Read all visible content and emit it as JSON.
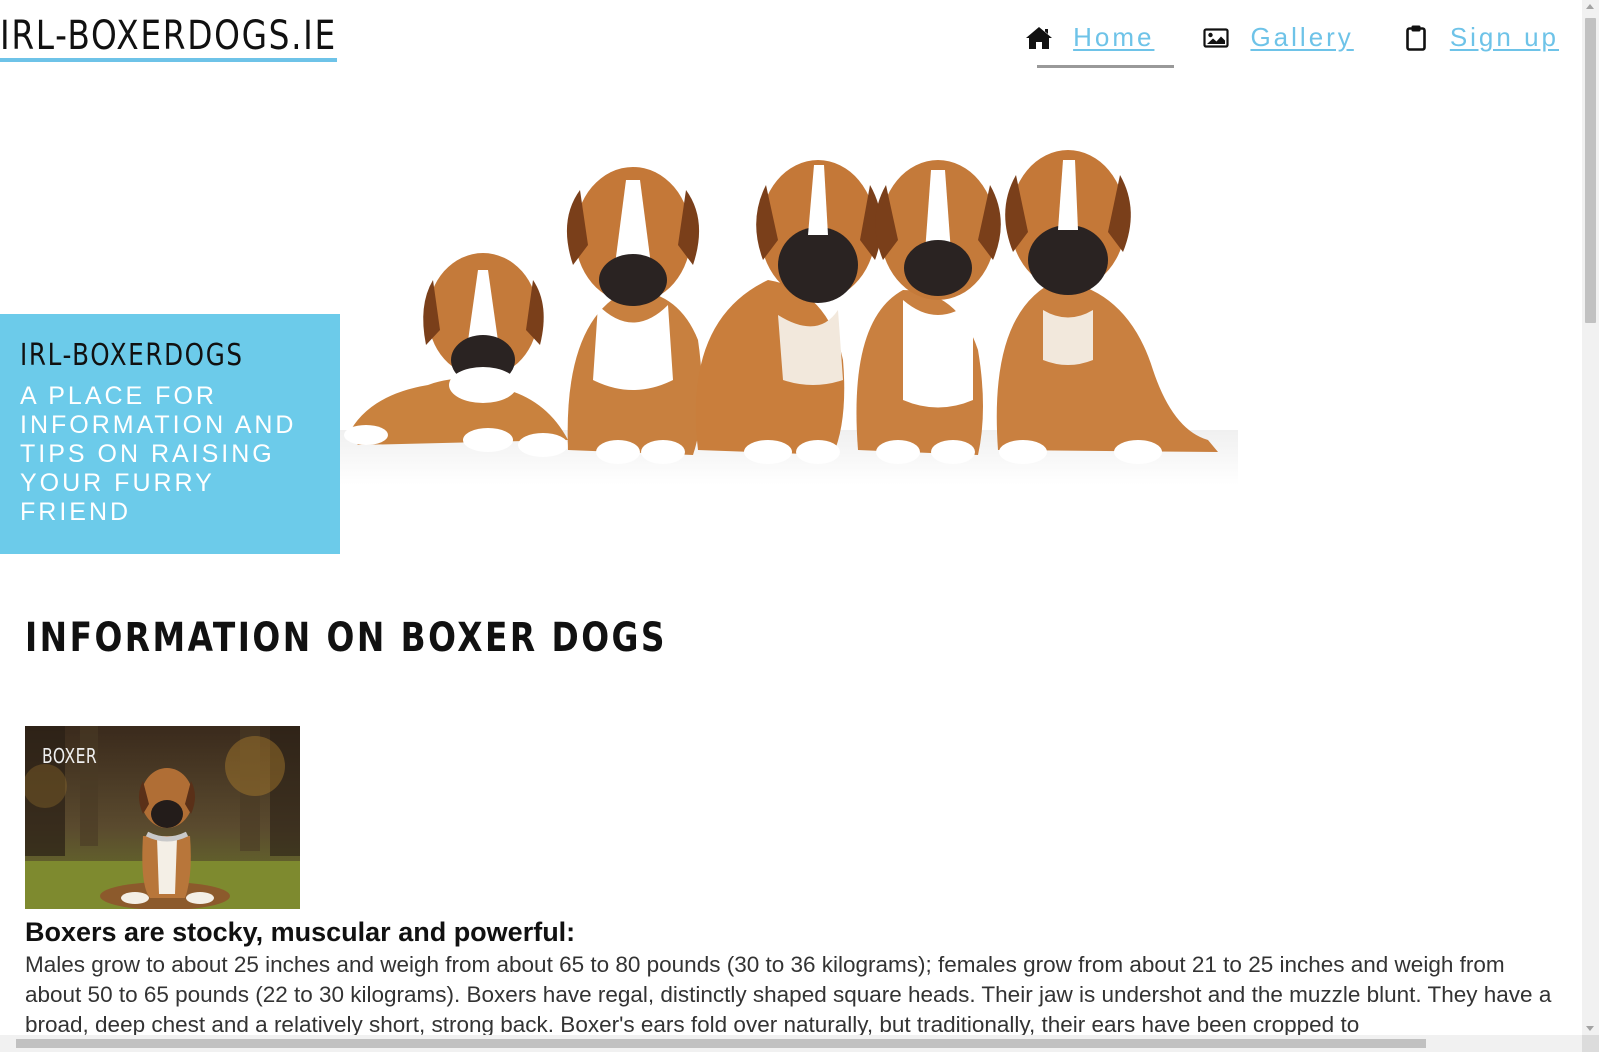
{
  "header": {
    "logo": "IRL-BOXERDOGS.IE",
    "nav": [
      {
        "label": "Home",
        "icon": "home-icon",
        "active": true
      },
      {
        "label": "Gallery",
        "icon": "image-icon",
        "active": false
      },
      {
        "label": "Sign up",
        "icon": "clipboard-icon",
        "active": false
      }
    ]
  },
  "hero": {
    "title": "IRL-BOXERDOGS",
    "subtitle": "A PLACE FOR INFORMATION AND TIPS ON RAISING YOUR FURRY FRIEND"
  },
  "main": {
    "heading": "INFORMATION ON BOXER DOGS",
    "card_label": "BOXER",
    "subheading": "Boxers are stocky, muscular and powerful:",
    "body": "Males grow to about 25 inches and weigh from about 65 to 80 pounds (30 to 36 kilograms); females grow from about 21 to 25 inches and weigh from about 50 to 65 pounds (22 to 30 kilograms). Boxers have regal, distinctly shaped square heads. Their jaw is undershot and the muzzle blunt. They have a broad, deep chest and a relatively short, strong back. Boxer's ears fold over naturally, but traditionally, their ears have been cropped to"
  },
  "colors": {
    "accent": "#6ccbea",
    "link": "#6ec3e8"
  }
}
